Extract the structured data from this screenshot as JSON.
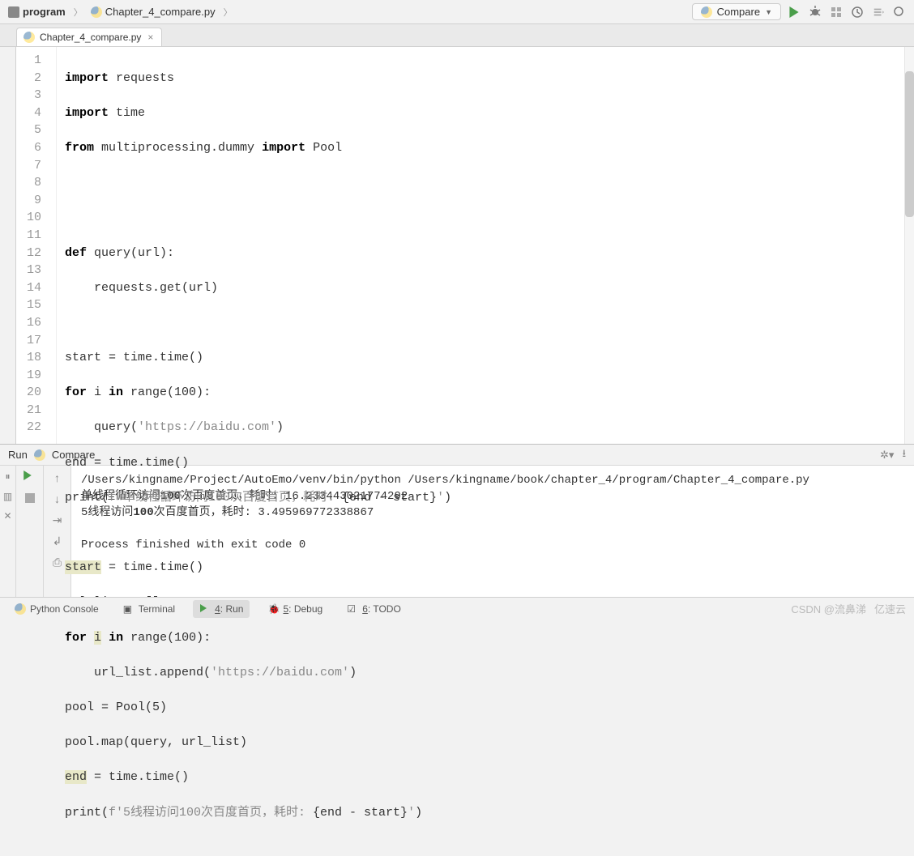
{
  "breadcrumb": {
    "project": "program",
    "file": "Chapter_4_compare.py"
  },
  "run_config": {
    "label": "Compare"
  },
  "editor_tab": {
    "label": "Chapter_4_compare.py"
  },
  "code": {
    "lines": [
      "import requests",
      "import time",
      "from multiprocessing.dummy import Pool",
      "",
      "",
      "def query(url):",
      "    requests.get(url)",
      "",
      "start = time.time()",
      "for i in range(100):",
      "    query('https://baidu.com')",
      "end = time.time()",
      "print(f'单线程循环访问100次百度首页，耗时: {end - start}')",
      "",
      "start = time.time()",
      "url_list = []",
      "for i in range(100):",
      "    url_list.append('https://baidu.com')",
      "pool = Pool(5)",
      "pool.map(query, url_list)",
      "end = time.time()",
      "print(f'5线程访问100次百度首页，耗时: {end - start}')"
    ]
  },
  "run_panel": {
    "title_prefix": "Run",
    "title_config": "Compare",
    "output": {
      "cmd": "/Users/kingname/Project/AutoEmo/venv/bin/python /Users/kingname/book/chapter_4/program/Chapter_4_compare.py",
      "line2_pre": "单线程循环访问",
      "line2_num": "100",
      "line2_post": "次百度首页，耗时: 16.233443021774292",
      "line3_pre": "5线程访问",
      "line3_num": "100",
      "line3_post": "次百度首页，耗时: 3.495969772338867",
      "exit": "Process finished with exit code 0"
    }
  },
  "bottom_tabs": {
    "python_console": "Python Console",
    "terminal": "Terminal",
    "run_num": "4",
    "run_label": ": Run",
    "debug_num": "5",
    "debug_label": ": Debug",
    "todo_num": "6",
    "todo_label": ": TODO"
  },
  "watermark": {
    "csdn": "CSDN @流鼻涕",
    "yisu": "亿速云"
  }
}
